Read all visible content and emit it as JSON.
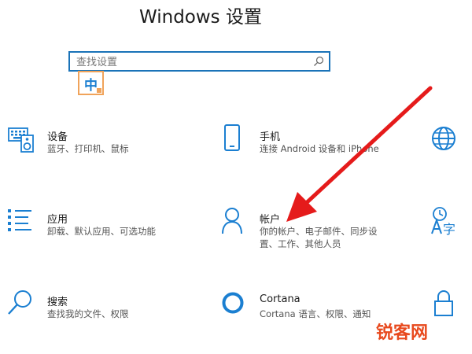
{
  "header": {
    "title": "Windows 设置"
  },
  "search": {
    "placeholder": "查找设置",
    "value": ""
  },
  "ime": {
    "indicator": "中"
  },
  "tiles": [
    {
      "id": "devices",
      "title": "设备",
      "desc1": "蓝牙、打印机、鼠标",
      "desc2": "",
      "icon": "keyboard-speaker-icon"
    },
    {
      "id": "phone",
      "title": "手机",
      "desc1": "连接 Android 设备和 iPhone",
      "desc2": "",
      "icon": "phone-icon"
    },
    {
      "id": "network",
      "title": "",
      "desc1": "",
      "desc2": "",
      "icon": "globe-icon"
    },
    {
      "id": "apps",
      "title": "应用",
      "desc1": "卸载、默认应用、可选功能",
      "desc2": "",
      "icon": "list-icon"
    },
    {
      "id": "accounts",
      "title": "帐户",
      "desc1": "你的帐户、电子邮件、同步设",
      "desc2": "置、工作、其他人员",
      "icon": "person-icon"
    },
    {
      "id": "time-language",
      "title": "",
      "desc1": "",
      "desc2": "",
      "icon": "time-language-icon"
    },
    {
      "id": "search",
      "title": "搜索",
      "desc1": "查找我的文件、权限",
      "desc2": "",
      "icon": "magnifier-icon"
    },
    {
      "id": "cortana",
      "title": "Cortana",
      "desc1": "Cortana 语言、权限、通知",
      "desc2": "",
      "icon": "cortana-ring-icon"
    },
    {
      "id": "privacy",
      "title": "",
      "desc1": "",
      "desc2": "",
      "icon": "lock-icon"
    }
  ],
  "icon_glyph_text": {
    "time_language_char": "字"
  },
  "annotation": {
    "arrow_color": "#e51b1b"
  },
  "watermark": {
    "text": "锐客网"
  },
  "colors": {
    "accent": "#1a73b8",
    "icon": "#1b7fd1",
    "ime_border": "#f0a35a"
  }
}
